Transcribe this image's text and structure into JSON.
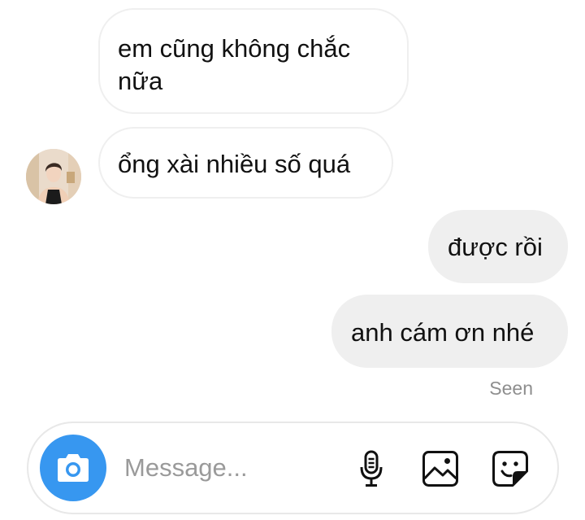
{
  "messages": [
    {
      "id": 1,
      "direction": "incoming",
      "text": "em cũng không chắc nữa"
    },
    {
      "id": 2,
      "direction": "incoming",
      "text": "ổng xài nhiều số quá"
    },
    {
      "id": 3,
      "direction": "outgoing",
      "text": "được rồi"
    },
    {
      "id": 4,
      "direction": "outgoing",
      "text": "anh cám ơn nhé"
    }
  ],
  "status": {
    "seen": "Seen"
  },
  "composer": {
    "placeholder": "Message...",
    "icons": {
      "camera": "camera-icon",
      "mic": "microphone-icon",
      "gallery": "image-icon",
      "sticker": "sticker-icon"
    }
  },
  "colors": {
    "accent": "#3797f0",
    "outgoing_bubble": "#efefef",
    "incoming_border": "#efefef",
    "seen_text": "#8e8e8e"
  }
}
